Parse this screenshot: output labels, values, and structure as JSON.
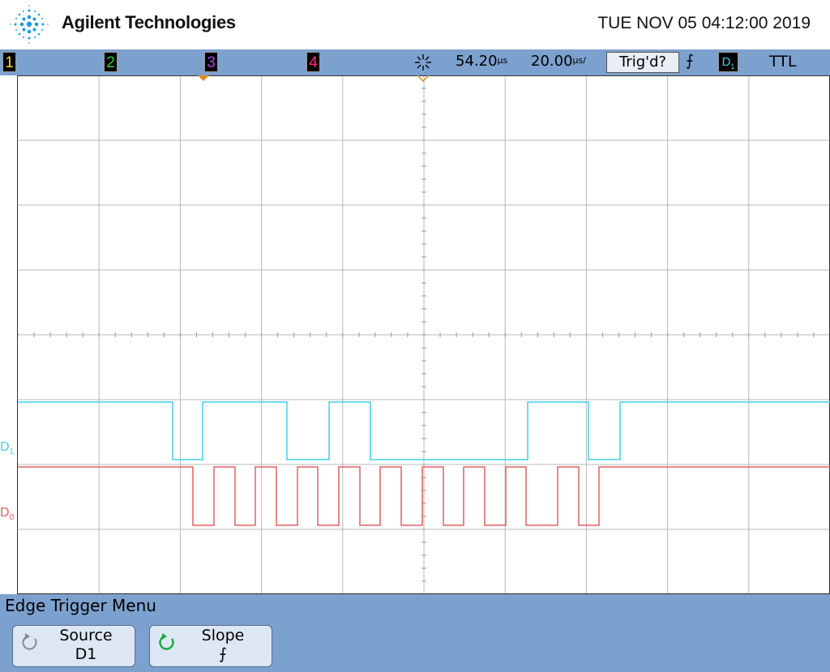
{
  "header": {
    "brand": "Agilent Technologies",
    "datetime": "TUE NOV 05 04:12:00 2019"
  },
  "status_bar": {
    "channels": [
      {
        "label": "1",
        "color": "#f0e020"
      },
      {
        "label": "2",
        "color": "#30d030"
      },
      {
        "label": "3",
        "color": "#b040e0"
      },
      {
        "label": "4",
        "color": "#ff3070"
      }
    ],
    "run_icon": "run-stop-icon",
    "time_delay": "54.20",
    "time_delay_unit": "µs",
    "time_scale": "20.00",
    "time_scale_unit": "µs/",
    "trigger_status": "Trig'd?",
    "trigger_slope_symbol": "⨍",
    "trigger_source_main": "D",
    "trigger_source_sub": "1",
    "trigger_level": "TTL"
  },
  "display": {
    "digital_channels": [
      {
        "label_main": "D",
        "label_sub": "1",
        "color": "#3fd0e6"
      },
      {
        "label_main": "D",
        "label_sub": "0",
        "color": "#e06060"
      }
    ],
    "markers": {
      "color": "#e08a20"
    }
  },
  "menu": {
    "title": "Edge Trigger Menu",
    "softkeys": [
      {
        "label": "Source",
        "value": "D1",
        "icon": "cycle-arrow-icon"
      },
      {
        "label": "Slope",
        "value": "⨍",
        "icon": "cycle-arrow-icon"
      }
    ]
  }
}
